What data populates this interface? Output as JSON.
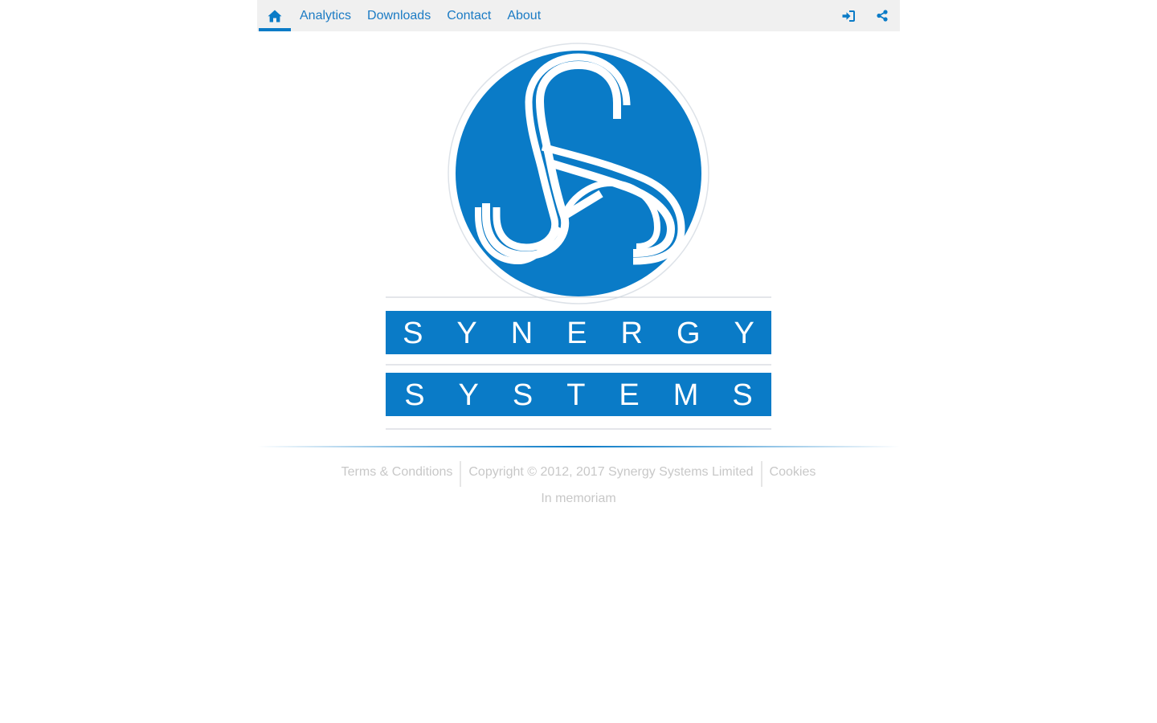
{
  "nav": {
    "home_icon": "home-icon",
    "links": [
      "Analytics",
      "Downloads",
      "Contact",
      "About"
    ],
    "login_icon": "sign-in-icon",
    "share_icon": "share-icon"
  },
  "logo": {
    "line1": "SYNERGY",
    "line2": "SYSTEMS"
  },
  "footer": {
    "terms": "Terms & Conditions",
    "copyright": "Copyright © 2012, 2017 Synergy Systems Limited",
    "cookies": "Cookies",
    "memoriam": "In memoriam"
  },
  "colors": {
    "brand_blue": "#0a7bc7",
    "nav_bg": "#f0f0f0",
    "link_blue": "#1b7bc4",
    "footer_text": "#c8c8c8"
  }
}
